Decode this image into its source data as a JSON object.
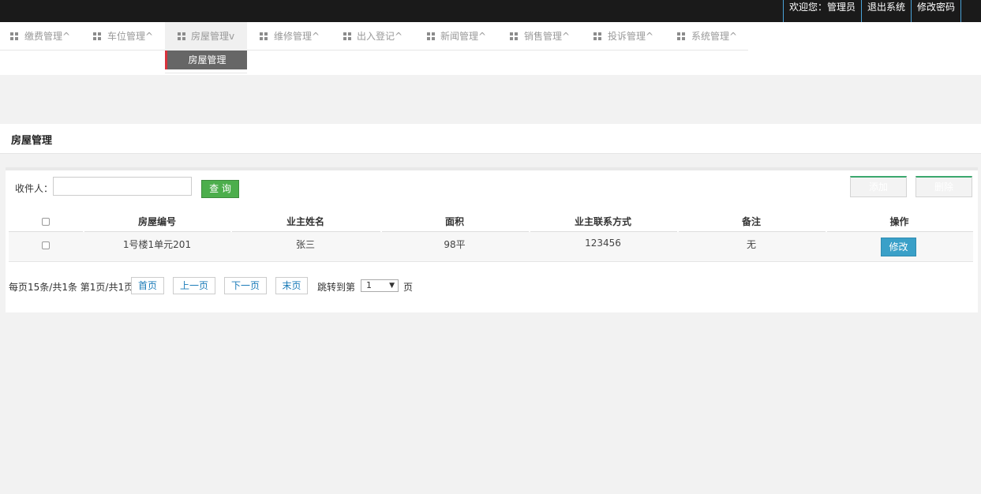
{
  "topbar": {
    "welcome": "欢迎您：管理员",
    "logout": "退出系统",
    "change_password": "修改密码"
  },
  "nav": {
    "items": [
      {
        "label": "缴费管理^"
      },
      {
        "label": "车位管理^"
      },
      {
        "label": "房屋管理v"
      },
      {
        "label": "维修管理^"
      },
      {
        "label": "出入登记^"
      },
      {
        "label": "新闻管理^"
      },
      {
        "label": "销售管理^"
      },
      {
        "label": "投诉管理^"
      },
      {
        "label": "系统管理^"
      }
    ],
    "active_index": 2,
    "submenu": {
      "label": "房屋管理"
    }
  },
  "page": {
    "title": "房屋管理"
  },
  "search": {
    "label": "收件人：",
    "value": "",
    "query_label": "查 询"
  },
  "actions": {
    "add_label": "添加",
    "delete_label": "删除"
  },
  "table": {
    "headers": [
      "房屋编号",
      "业主姓名",
      "面积",
      "业主联系方式",
      "备注",
      "操作"
    ],
    "rows": [
      {
        "house_no": "1号楼1单元201",
        "owner": "张三",
        "area": "98平",
        "phone": "123456",
        "note": "无",
        "action": "修改"
      }
    ]
  },
  "pager": {
    "summary": "每页15条/共1条 第1页/共1页",
    "first": "首页",
    "prev": "上一页",
    "next": "下一页",
    "last": "末页",
    "jump_label": "跳转到第",
    "jump_value": "1",
    "jump_suffix": "页"
  },
  "colors": {
    "topbar": "#1a1a1a",
    "accent_red": "#d9323c",
    "query_green": "#4cae4c",
    "edit_blue": "#3aa0c8",
    "link_blue": "#1a7bb8"
  }
}
